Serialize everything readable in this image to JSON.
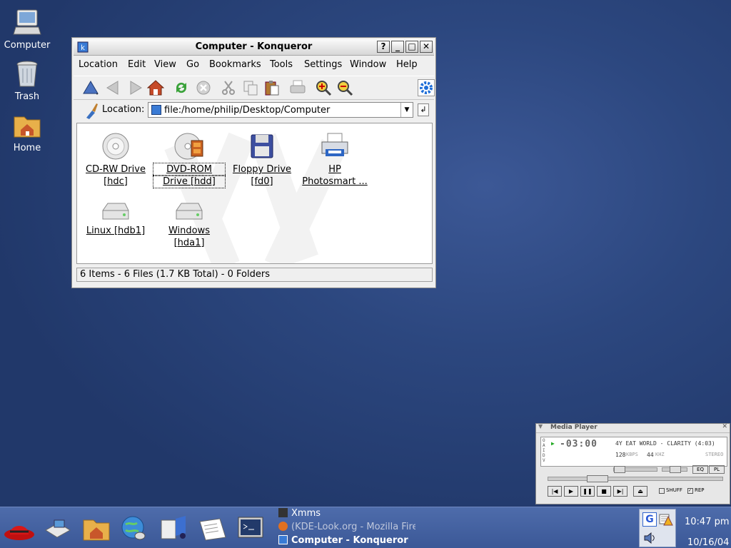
{
  "desktop": {
    "icons": [
      {
        "label": "Computer",
        "icon": "computer-icon"
      },
      {
        "label": "Trash",
        "icon": "trash-icon"
      },
      {
        "label": "Home",
        "icon": "home-folder-icon"
      }
    ]
  },
  "window": {
    "title": "Computer - Konqueror",
    "title_buttons": {
      "help": "?",
      "minimize": "_",
      "maximize": "□",
      "close": "✕"
    },
    "menu": [
      "Location",
      "Edit",
      "View",
      "Go",
      "Bookmarks",
      "Tools",
      "Settings",
      "Window",
      "Help"
    ],
    "location_label": "Location:",
    "location_value": "file:/home/philip/Desktop/Computer",
    "files": [
      {
        "line1": "CD-RW Drive",
        "line2": "[hdc]",
        "icon": "cd-drive-icon"
      },
      {
        "line1": "DVD-ROM",
        "line2": "Drive [hdd]",
        "icon": "dvd-drive-icon"
      },
      {
        "line1": "Floppy Drive",
        "line2": "[fd0]",
        "icon": "floppy-icon"
      },
      {
        "line1": "HP",
        "line2": "Photosmart ...",
        "icon": "printer-icon"
      },
      {
        "line1": "Linux [hdb1]",
        "line2": "",
        "icon": "hard-disk-icon"
      },
      {
        "line1": "Windows",
        "line2": "[hda1]",
        "icon": "hard-disk-icon"
      }
    ],
    "status": "6 Items - 6 Files (1.7 KB Total) - 0 Folders"
  },
  "media_player": {
    "title": "Media Player",
    "time": "-03:00",
    "track": "4Y EAT WORLD - CLARITY (4:03)",
    "kbps": "128",
    "kbps_unit": "KBPS",
    "khz": "44",
    "khz_unit": "KHZ",
    "mode": "STEREO",
    "eq": "EQ",
    "pl": "PL",
    "shuffle": "SHUFF",
    "repeat": "REP",
    "side_letters": "OAIDV"
  },
  "taskbar": {
    "tasks": [
      {
        "label": "Xmms",
        "active": false
      },
      {
        "label": "(KDE-Look.org - Mozilla Fire",
        "active": false
      },
      {
        "label": "Computer - Konqueror",
        "active": true
      }
    ],
    "clock_time": "10:47 pm",
    "clock_date": "10/16/04"
  },
  "colors": {
    "desktop": "#2c477f",
    "taskbar": "#4566a6",
    "accent": "#3b5897"
  }
}
